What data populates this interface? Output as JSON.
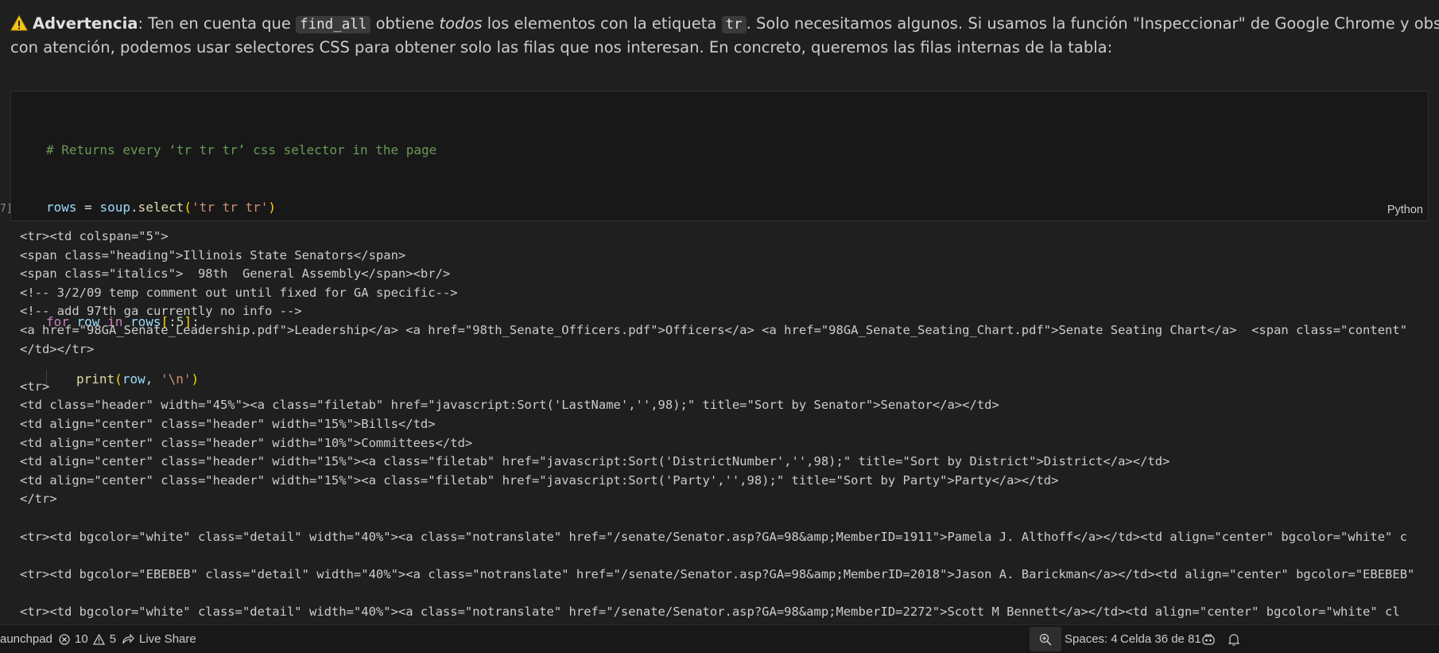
{
  "markdown": {
    "warning_label": "Advertencia",
    "line1_after_label": ": Ten en cuenta que ",
    "code_find_all": "find_all",
    "line1_obtiene": " obtiene ",
    "line1_todos": "todos",
    "line1_los": " los elementos con la etiqueta ",
    "code_tr": "tr",
    "line1_rest": ". Solo necesitamos algunos. Si usamos la función \"Inspeccionar\" de Google Chrome y observamos",
    "line2": "con atención, podemos usar selectores CSS para obtener solo las filas que nos interesan. En concreto, queremos las filas internas de la tabla:"
  },
  "code_cell": {
    "comment": "# Returns every ‘tr tr tr’ css selector in the page",
    "l2_var": "rows",
    "l2_eq": " = ",
    "l2_obj": "soup",
    "l2_dot": ".",
    "l2_func": "select",
    "l2_open": "(",
    "l2_str": "'tr tr tr'",
    "l2_close": ")",
    "l4_for": "for",
    "l4_row": " row ",
    "l4_in": "in",
    "l4_rows": " rows",
    "l4_open": "[",
    "l4_slice": ":",
    "l4_num": "5",
    "l4_close": "]",
    "l4_colon": ":",
    "l5_func": "print",
    "l5_open": "(",
    "l5_arg": "row",
    "l5_comma": ", ",
    "l5_str": "'\\n'",
    "l5_close": ")",
    "language": "Python",
    "gutter": "7]"
  },
  "output_lines": [
    "<tr><td colspan=\"5\">",
    "<span class=\"heading\">Illinois State Senators</span>",
    "<span class=\"italics\">  98th  General Assembly</span><br/>",
    "<!-- 3/2/09 temp comment out until fixed for GA specific-->",
    "<!-- add 97th ga currently no info -->",
    "<a href=\"98GA_Senate_Leadership.pdf\">Leadership</a> <a href=\"98th_Senate_Officers.pdf\">Officers</a> <a href=\"98GA_Senate_Seating_Chart.pdf\">Senate Seating Chart</a>  <span class=\"content\"",
    "</td></tr>",
    "",
    "<tr>",
    "<td class=\"header\" width=\"45%\"><a class=\"filetab\" href=\"javascript:Sort('LastName','',98);\" title=\"Sort by Senator\">Senator</a></td>",
    "<td align=\"center\" class=\"header\" width=\"15%\">Bills</td>",
    "<td align=\"center\" class=\"header\" width=\"10%\">Committees</td>",
    "<td align=\"center\" class=\"header\" width=\"15%\"><a class=\"filetab\" href=\"javascript:Sort('DistrictNumber','',98);\" title=\"Sort by District\">District</a></td>",
    "<td align=\"center\" class=\"header\" width=\"15%\"><a class=\"filetab\" href=\"javascript:Sort('Party','',98);\" title=\"Sort by Party\">Party</a></td>",
    "</tr>",
    "",
    "<tr><td bgcolor=\"white\" class=\"detail\" width=\"40%\"><a class=\"notranslate\" href=\"/senate/Senator.asp?GA=98&amp;MemberID=1911\">Pamela J. Althoff</a></td><td align=\"center\" bgcolor=\"white\" c",
    "",
    "<tr><td bgcolor=\"EBEBEB\" class=\"detail\" width=\"40%\"><a class=\"notranslate\" href=\"/senate/Senator.asp?GA=98&amp;MemberID=2018\">Jason A. Barickman</a></td><td align=\"center\" bgcolor=\"EBEBEB\"",
    "",
    "<tr><td bgcolor=\"white\" class=\"detail\" width=\"40%\"><a class=\"notranslate\" href=\"/senate/Senator.asp?GA=98&amp;MemberID=2272\">Scott M Bennett</a></td><td align=\"center\" bgcolor=\"white\" cl"
  ],
  "statusbar": {
    "launchpad": "aunchpad",
    "errors": "10",
    "warnings": "5",
    "live_share": "Live Share",
    "spaces": "Spaces: 4",
    "cell": "Celda 36 de 81"
  }
}
